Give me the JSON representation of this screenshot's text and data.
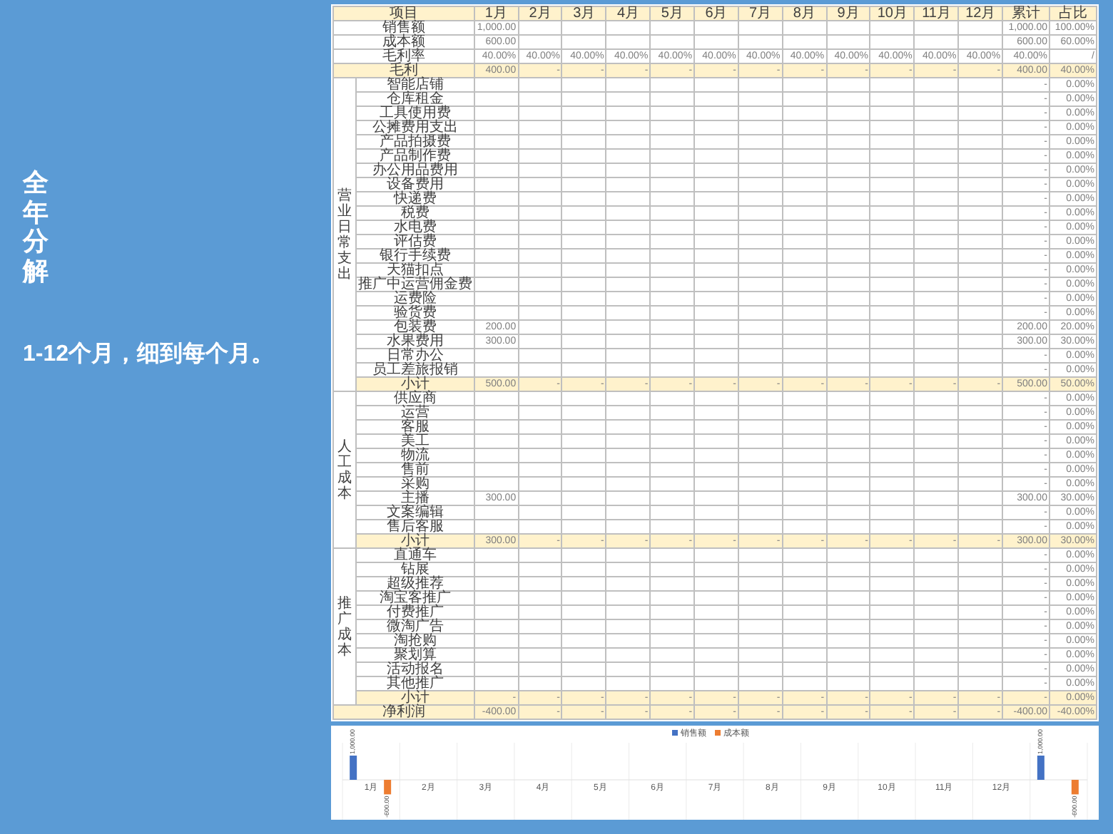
{
  "side": {
    "title": "全年分解",
    "subtitle": "1-12个月，细到每个月。"
  },
  "table": {
    "columns": [
      "项目",
      "1月",
      "2月",
      "3月",
      "4月",
      "5月",
      "6月",
      "7月",
      "8月",
      "9月",
      "10月",
      "11月",
      "12月",
      "累计",
      "占比"
    ],
    "summary_rows": [
      {
        "label": "销售额",
        "kind": "item",
        "months": [
          "1,000.00"
        ],
        "total": "1,000.00",
        "ratio": "100.00%"
      },
      {
        "label": "成本额",
        "kind": "item",
        "months": [
          "600.00"
        ],
        "total": "600.00",
        "ratio": "60.00%"
      },
      {
        "label": "毛利率",
        "kind": "item",
        "months": [
          "40.00%",
          "40.00%",
          "40.00%",
          "40.00%",
          "40.00%",
          "40.00%",
          "40.00%",
          "40.00%",
          "40.00%",
          "40.00%",
          "40.00%",
          "40.00%"
        ],
        "total": "40.00%",
        "ratio": "/"
      },
      {
        "label": "毛利",
        "kind": "total",
        "months": [
          "400.00",
          "-",
          "-",
          "-",
          "-",
          "-",
          "-",
          "-",
          "-",
          "-",
          "-",
          "-"
        ],
        "total": "400.00",
        "ratio": "40.00%"
      }
    ],
    "groups": [
      {
        "label": "营业日常支出",
        "rows": [
          {
            "label": "智能店铺",
            "kind": "item",
            "total": "-",
            "ratio": "0.00%"
          },
          {
            "label": "仓库租金",
            "kind": "item",
            "total": "-",
            "ratio": "0.00%"
          },
          {
            "label": "工具使用费",
            "kind": "item",
            "total": "-",
            "ratio": "0.00%"
          },
          {
            "label": "公摊费用支出",
            "kind": "item",
            "total": "-",
            "ratio": "0.00%"
          },
          {
            "label": "产品拍摄费",
            "kind": "item",
            "total": "-",
            "ratio": "0.00%"
          },
          {
            "label": "产品制作费",
            "kind": "item",
            "total": "-",
            "ratio": "0.00%"
          },
          {
            "label": "办公用品费用",
            "kind": "item",
            "total": "-",
            "ratio": "0.00%"
          },
          {
            "label": "设备费用",
            "kind": "item",
            "total": "-",
            "ratio": "0.00%"
          },
          {
            "label": "快递费",
            "kind": "item",
            "total": "-",
            "ratio": "0.00%"
          },
          {
            "label": "税费",
            "kind": "item",
            "total": "-",
            "ratio": "0.00%"
          },
          {
            "label": "水电费",
            "kind": "item",
            "total": "-",
            "ratio": "0.00%"
          },
          {
            "label": "评估费",
            "kind": "item",
            "total": "-",
            "ratio": "0.00%"
          },
          {
            "label": "银行手续费",
            "kind": "item",
            "total": "-",
            "ratio": "0.00%"
          },
          {
            "label": "天猫扣点",
            "kind": "item",
            "total": "-",
            "ratio": "0.00%"
          },
          {
            "label": "推广中运营佣金费",
            "kind": "item",
            "total": "-",
            "ratio": "0.00%"
          },
          {
            "label": "运费险",
            "kind": "item",
            "total": "-",
            "ratio": "0.00%"
          },
          {
            "label": "验货费",
            "kind": "item",
            "total": "-",
            "ratio": "0.00%"
          },
          {
            "label": "包装费",
            "kind": "item",
            "months": [
              "200.00"
            ],
            "total": "200.00",
            "ratio": "20.00%"
          },
          {
            "label": "水果费用",
            "kind": "item",
            "months": [
              "300.00"
            ],
            "total": "300.00",
            "ratio": "30.00%"
          },
          {
            "label": "日常办公",
            "kind": "item",
            "total": "-",
            "ratio": "0.00%"
          },
          {
            "label": "员工差旅报销",
            "kind": "item",
            "total": "-",
            "ratio": "0.00%"
          },
          {
            "label": "小计",
            "kind": "total",
            "months": [
              "500.00",
              "-",
              "-",
              "-",
              "-",
              "-",
              "-",
              "-",
              "-",
              "-",
              "-",
              "-"
            ],
            "total": "500.00",
            "ratio": "50.00%"
          }
        ]
      },
      {
        "label": "人工成本",
        "rows": [
          {
            "label": "供应商",
            "kind": "item",
            "total": "-",
            "ratio": "0.00%"
          },
          {
            "label": "运营",
            "kind": "item",
            "total": "-",
            "ratio": "0.00%"
          },
          {
            "label": "客服",
            "kind": "item",
            "total": "-",
            "ratio": "0.00%"
          },
          {
            "label": "美工",
            "kind": "item",
            "total": "-",
            "ratio": "0.00%"
          },
          {
            "label": "物流",
            "kind": "item",
            "total": "-",
            "ratio": "0.00%"
          },
          {
            "label": "售前",
            "kind": "item",
            "total": "-",
            "ratio": "0.00%"
          },
          {
            "label": "采购",
            "kind": "item",
            "total": "-",
            "ratio": "0.00%"
          },
          {
            "label": "主播",
            "kind": "item",
            "months": [
              "300.00"
            ],
            "total": "300.00",
            "ratio": "30.00%"
          },
          {
            "label": "文案编辑",
            "kind": "item",
            "total": "-",
            "ratio": "0.00%"
          },
          {
            "label": "售后客服",
            "kind": "item",
            "total": "-",
            "ratio": "0.00%"
          },
          {
            "label": "小计",
            "kind": "total",
            "months": [
              "300.00",
              "-",
              "-",
              "-",
              "-",
              "-",
              "-",
              "-",
              "-",
              "-",
              "-",
              "-"
            ],
            "total": "300.00",
            "ratio": "30.00%"
          }
        ]
      },
      {
        "label": "推广成本",
        "rows": [
          {
            "label": "直通车",
            "kind": "item",
            "total": "-",
            "ratio": "0.00%"
          },
          {
            "label": "钻展",
            "kind": "item",
            "total": "-",
            "ratio": "0.00%"
          },
          {
            "label": "超级推荐",
            "kind": "item",
            "total": "-",
            "ratio": "0.00%"
          },
          {
            "label": "淘宝客推广",
            "kind": "item",
            "total": "-",
            "ratio": "0.00%"
          },
          {
            "label": "付费推广",
            "kind": "item",
            "total": "-",
            "ratio": "0.00%"
          },
          {
            "label": "微淘广告",
            "kind": "item",
            "total": "-",
            "ratio": "0.00%"
          },
          {
            "label": "淘抢购",
            "kind": "item",
            "total": "-",
            "ratio": "0.00%"
          },
          {
            "label": "聚划算",
            "kind": "item",
            "total": "-",
            "ratio": "0.00%"
          },
          {
            "label": "活动报名",
            "kind": "item",
            "total": "-",
            "ratio": "0.00%"
          },
          {
            "label": "其他推广",
            "kind": "item",
            "total": "-",
            "ratio": "0.00%"
          },
          {
            "label": "小计",
            "kind": "total",
            "months": [
              "-",
              "-",
              "-",
              "-",
              "-",
              "-",
              "-",
              "-",
              "-",
              "-",
              "-",
              "-"
            ],
            "total": "-",
            "ratio": "0.00%"
          }
        ]
      }
    ],
    "footer_rows": [
      {
        "label": "净利润",
        "kind": "total",
        "months": [
          "-400.00",
          "-",
          "-",
          "-",
          "-",
          "-",
          "-",
          "-",
          "-",
          "-",
          "-",
          "-"
        ],
        "total": "-400.00",
        "ratio": "-40.00%"
      }
    ]
  },
  "chart": {
    "chart_data": {
      "type": "bar",
      "categories": [
        "1月",
        "2月",
        "3月",
        "4月",
        "5月",
        "6月",
        "7月",
        "8月",
        "9月",
        "10月",
        "11月",
        "12月",
        null
      ],
      "series": [
        {
          "name": "销售额",
          "color": "#4472c4",
          "values": [
            1000,
            null,
            null,
            null,
            null,
            null,
            null,
            null,
            null,
            null,
            null,
            null,
            1000
          ],
          "value_labels": [
            "1,000.00",
            null,
            null,
            null,
            null,
            null,
            null,
            null,
            null,
            null,
            null,
            null,
            "1,000.00"
          ]
        },
        {
          "name": "成本额",
          "color": "#ed7d31",
          "values": [
            -600,
            null,
            null,
            null,
            null,
            null,
            null,
            null,
            null,
            null,
            null,
            null,
            -600
          ],
          "value_labels": [
            "-600.00",
            null,
            null,
            null,
            null,
            null,
            null,
            null,
            null,
            null,
            null,
            null,
            "-600.00"
          ]
        }
      ],
      "data_labels": true,
      "legend": "top"
    }
  }
}
